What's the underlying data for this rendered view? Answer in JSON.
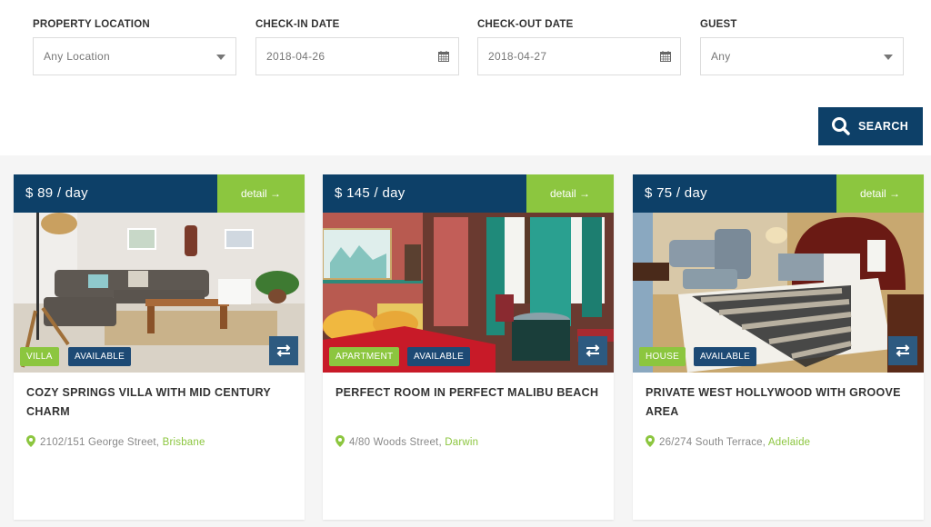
{
  "search": {
    "fields": [
      {
        "label": "PROPERTY LOCATION",
        "value": "Any Location",
        "type": "select"
      },
      {
        "label": "CHECK-IN DATE",
        "value": "2018-04-26",
        "type": "date"
      },
      {
        "label": "CHECK-OUT DATE",
        "value": "2018-04-27",
        "type": "date"
      },
      {
        "label": "GUEST",
        "value": "Any",
        "type": "select"
      }
    ],
    "button_label": "SEARCH"
  },
  "colors": {
    "primary": "#0d4068",
    "accent": "#8cc63f"
  },
  "listings": [
    {
      "price": "$ 89 / day",
      "detail_label": "detail →",
      "type_tag": "VILLA",
      "status_tag": "AVAILABLE",
      "title": "COZY SPRINGS VILLA WITH MID CENTURY CHARM",
      "street": "2102/151 George Street,",
      "city": "Brisbane",
      "image_subject": "living room with grey sofa"
    },
    {
      "price": "$ 145 / day",
      "detail_label": "detail →",
      "type_tag": "APARTMENT",
      "status_tag": "AVAILABLE",
      "title": "PERFECT ROOM IN PERFECT MALIBU BEACH",
      "street": "4/80 Woods Street,",
      "city": "Darwin",
      "image_subject": "red bedroom with teal curtains"
    },
    {
      "price": "$ 75 / day",
      "detail_label": "detail →",
      "type_tag": "HOUSE",
      "status_tag": "AVAILABLE",
      "title": "PRIVATE WEST HOLLYWOOD WITH GROOVE AREA",
      "street": "26/274 South Terrace,",
      "city": "Adelaide",
      "image_subject": "hotel bedroom with striped runner"
    }
  ]
}
